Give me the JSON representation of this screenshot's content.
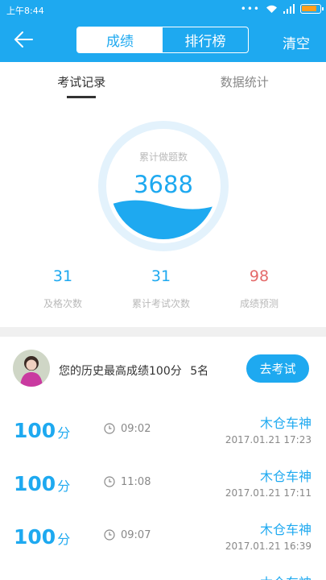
{
  "status_bar": {
    "time": "上午8:44"
  },
  "header": {
    "tabs": [
      "成绩",
      "排行榜"
    ],
    "right_action": "清空"
  },
  "inner_tabs": [
    "考试记录",
    "数据统计"
  ],
  "summary": {
    "label": "累计做题数",
    "value": "3688"
  },
  "stats": [
    {
      "value": "31",
      "label": "及格次数"
    },
    {
      "value": "31",
      "label": "累计考试次数"
    },
    {
      "value": "98",
      "label": "成绩预测"
    }
  ],
  "best": {
    "text": "您的历史最高成绩100分",
    "rank": "5名",
    "button": "去考试"
  },
  "records": [
    {
      "score": "100",
      "unit": "分",
      "duration": "09:02",
      "name": "木仓车神",
      "date": "2017.01.21  17:23"
    },
    {
      "score": "100",
      "unit": "分",
      "duration": "11:08",
      "name": "木仓车神",
      "date": "2017.01.21  17:11"
    },
    {
      "score": "100",
      "unit": "分",
      "duration": "09:07",
      "name": "木仓车神",
      "date": "2017.01.21  16:39"
    }
  ],
  "partial_record": {
    "name": "木仓车神"
  },
  "colors": {
    "accent": "#1ea9f0",
    "prediction": "#e46a6a",
    "muted": "#b9b9b9",
    "battery": "#ff9e1e"
  },
  "icons": [
    "signal-icon",
    "wifi-icon",
    "battery-icon",
    "back-arrow-icon",
    "clock-icon"
  ]
}
